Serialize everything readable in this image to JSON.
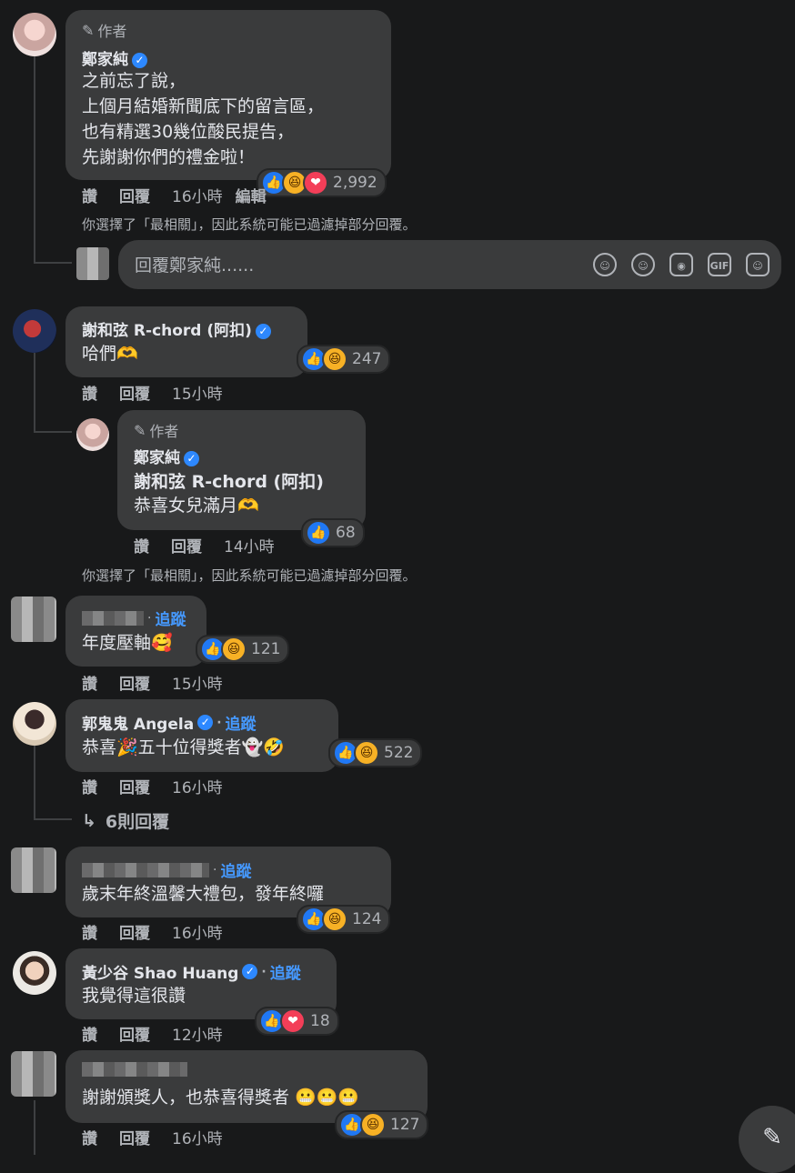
{
  "labels": {
    "like": "讚",
    "reply": "回覆",
    "follow": "追蹤",
    "author": "作者"
  },
  "notice_text": "你選擇了「最相關」，因此系統可能已過濾掉部分回覆。",
  "reply_input": {
    "placeholder": "回覆鄭家純......"
  },
  "comments": [
    {
      "id": "c1",
      "author_badge": "作者",
      "name": "鄭家純",
      "verified": true,
      "lines": [
        "之前忘了說，",
        "上個月結婚新聞底下的留言區，",
        "也有精選30幾位酸民提告，",
        "先謝謝你們的禮金啦！"
      ],
      "reactions": [
        "like",
        "haha",
        "love"
      ],
      "count": "2,992",
      "time": "16小時",
      "extra_action": "編輯"
    },
    {
      "id": "c2",
      "name": "謝和弦 R-chord (阿扣)",
      "verified": true,
      "lines": [
        "哈們🫶"
      ],
      "reactions": [
        "like",
        "haha"
      ],
      "count": "247",
      "time": "15小時"
    },
    {
      "id": "c2r",
      "author_badge": "作者",
      "name": "鄭家純",
      "verified": true,
      "mention": "謝和弦 R-chord (阿扣)",
      "lines": [
        "恭喜女兒滿月🫶"
      ],
      "reactions": [
        "like"
      ],
      "count": "68",
      "time": "14小時"
    },
    {
      "id": "c3",
      "follow": true,
      "lines": [
        "年度壓軸🥰"
      ],
      "reactions": [
        "like",
        "haha"
      ],
      "count": "121",
      "time": "15小時"
    },
    {
      "id": "c4",
      "name": "郭鬼鬼 Angela",
      "verified": true,
      "follow": true,
      "lines": [
        "恭喜🎉五十位得獎者👻🤣"
      ],
      "reactions": [
        "like",
        "haha"
      ],
      "count": "522",
      "time": "16小時",
      "more_replies": "6則回覆"
    },
    {
      "id": "c5",
      "follow": true,
      "lines": [
        "歲末年終溫馨大禮包，發年終囉"
      ],
      "reactions": [
        "like",
        "haha"
      ],
      "count": "124",
      "time": "16小時"
    },
    {
      "id": "c6",
      "name": "黃少谷 Shao Huang",
      "verified": true,
      "follow": true,
      "lines": [
        "我覺得這很讚"
      ],
      "reactions": [
        "like",
        "love"
      ],
      "count": "18",
      "time": "12小時"
    },
    {
      "id": "c7",
      "lines": [
        "謝謝頒獎人，也恭喜得獎者 😬😬😬"
      ],
      "reactions": [
        "like",
        "haha"
      ],
      "count": "127",
      "time": "16小時"
    }
  ],
  "icons": {
    "like": "👍",
    "haha": "😆",
    "love": "❤",
    "toolbar": [
      "avatar-sticker-icon",
      "emoji-icon",
      "camera-icon",
      "gif-icon",
      "sticker-icon"
    ],
    "fab": "compose-icon"
  },
  "colors": {
    "background": "#18191a",
    "bubble": "#3a3b3c",
    "link": "#4599ff",
    "verified": "#2d88ff"
  }
}
